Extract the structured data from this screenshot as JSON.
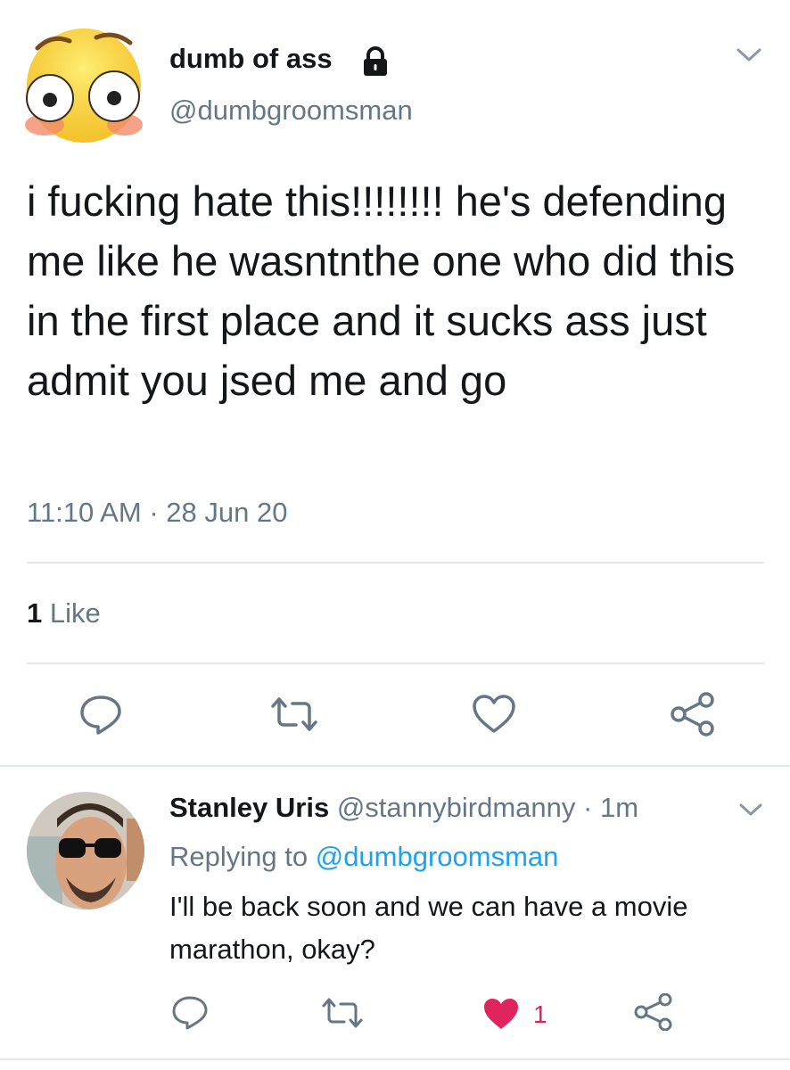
{
  "tweet": {
    "author_name": "dumb of ass",
    "author_handle": "@dumbgroomsman",
    "protected_icon": "lock-icon",
    "text": "i fucking hate this!!!!!!!! he's defending me like he wasntnthe one who did this in the first place and it sucks ass just admit you jsed me and go",
    "time": "11:10 AM",
    "separator": "·",
    "date": "28 Jun 20",
    "likes_count": "1",
    "likes_label": "Like",
    "actions": [
      "reply-icon",
      "retweet-icon",
      "like-icon",
      "share-icon"
    ]
  },
  "reply": {
    "author_name": "Stanley Uris",
    "author_handle": "@stannybirdmanny",
    "separator": "·",
    "time_ago": "1m",
    "replying_prefix": "Replying to",
    "replying_handle": "@dumbgroomsman",
    "text": "I'll be back soon and we can have a movie marathon, okay?",
    "like_count": "1",
    "liked": true,
    "actions": [
      "reply-icon",
      "retweet-icon",
      "like-icon-filled",
      "share-icon"
    ]
  },
  "colors": {
    "text_primary": "#14171a",
    "text_secondary": "#657786",
    "link": "#1da1f2",
    "like_active": "#e0245e",
    "divider": "#e1e8ed"
  }
}
